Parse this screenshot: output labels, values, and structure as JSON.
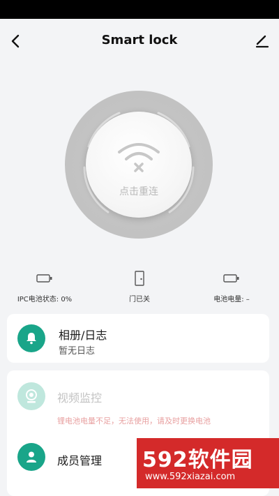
{
  "header": {
    "title": "Smart lock"
  },
  "dial": {
    "label": "点击重连"
  },
  "status": [
    {
      "label": "IPC电池状态: 0%"
    },
    {
      "label": "门已关"
    },
    {
      "label": "电池电量: –"
    }
  ],
  "log_card": {
    "title": "相册/日志",
    "subtitle": "暂无日志"
  },
  "video_card": {
    "title": "视频监控",
    "warning": "锂电池电量不足，无法使用，请及时更换电池"
  },
  "members_card": {
    "title": "成员管理"
  },
  "watermark": {
    "main": "592软件园",
    "sub": "www.592xiazai.com"
  },
  "colors": {
    "accent": "#19a589",
    "warning": "#e8a0a0",
    "watermark_bg": "#d42a2a"
  }
}
